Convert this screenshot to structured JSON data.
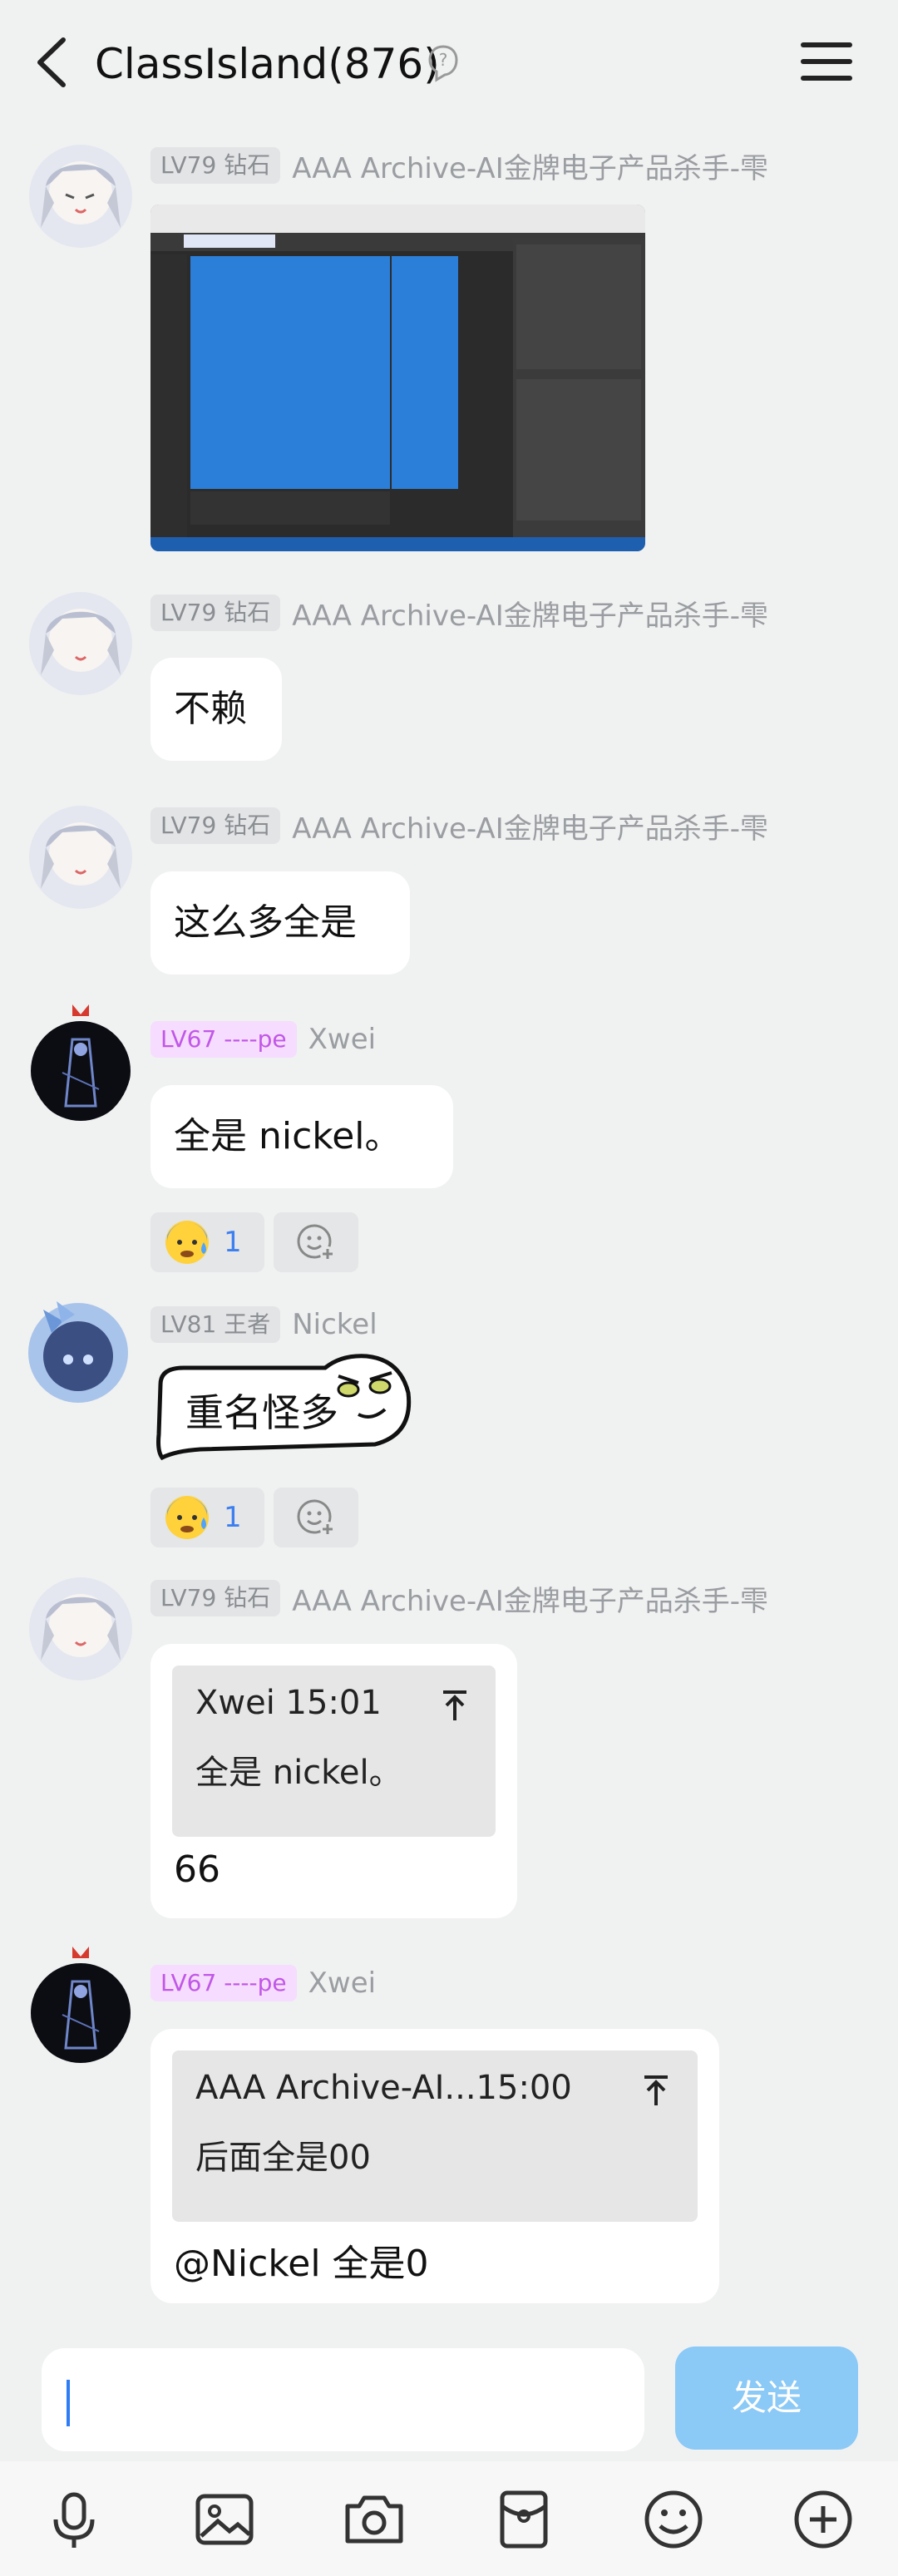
{
  "header": {
    "title": "ClassIsland(876)"
  },
  "messages": [
    {
      "level": "LV79 钻石",
      "name": "AAA Archive-AI金牌电子产品杀手-雫",
      "type": "image"
    },
    {
      "level": "LV79 钻石",
      "name": "AAA Archive-AI金牌电子产品杀手-雫",
      "text": "不赖"
    },
    {
      "level": "LV79 钻石",
      "name": "AAA Archive-AI金牌电子产品杀手-雫",
      "text": "这么多全是"
    },
    {
      "level": "LV67 ----pe",
      "name": "Xwei",
      "text": "全是 nickel。",
      "reaction_count": "1"
    },
    {
      "level": "LV81 王者",
      "name": "Nickel",
      "sticker_text": "重名怪多",
      "reaction_count": "1"
    },
    {
      "level": "LV79 钻石",
      "name": "AAA Archive-AI金牌电子产品杀手-雫",
      "quote_header": "Xwei 15:01",
      "quote_text": "全是 nickel。",
      "text": "66"
    },
    {
      "level": "LV67 ----pe",
      "name": "Xwei",
      "quote_header": "AAA Archive-AI...15:00",
      "quote_text": "后面全是00",
      "text": "@Nickel 全是0"
    }
  ],
  "input": {
    "value": "",
    "send_label": "发送"
  },
  "toolbar": [
    "microphone-icon",
    "image-icon",
    "camera-icon",
    "red-packet-icon",
    "emoji-icon",
    "add-icon"
  ]
}
